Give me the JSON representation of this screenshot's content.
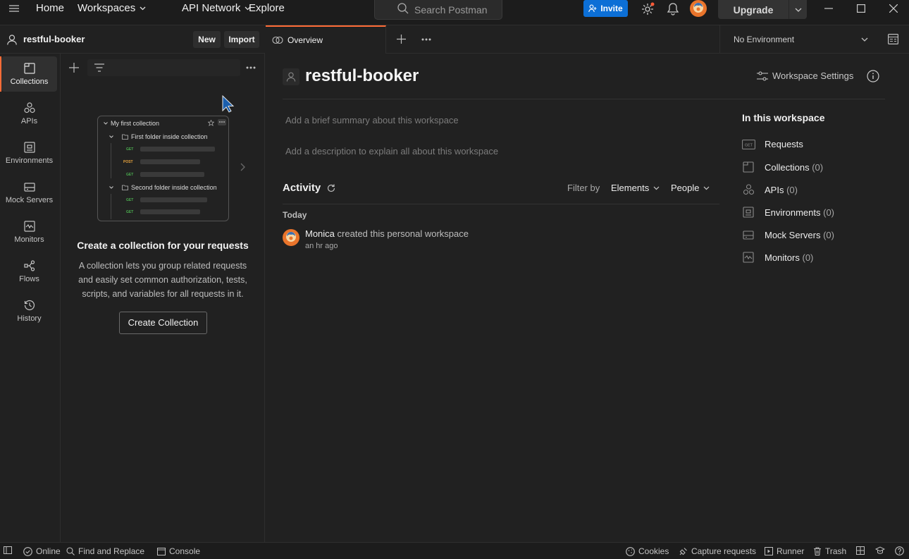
{
  "topbar": {
    "nav": [
      "Home",
      "Workspaces",
      "API Network",
      "Explore"
    ],
    "search_placeholder": "Search Postman",
    "invite_label": "Invite",
    "upgrade_label": "Upgrade"
  },
  "workspace": {
    "name": "restful-booker",
    "new_label": "New",
    "import_label": "Import"
  },
  "sidebar": {
    "items": [
      {
        "label": "Collections",
        "icon": "collections-icon",
        "active": true
      },
      {
        "label": "APIs",
        "icon": "apis-icon"
      },
      {
        "label": "Environments",
        "icon": "environments-icon"
      },
      {
        "label": "Mock Servers",
        "icon": "mock-servers-icon"
      },
      {
        "label": "Monitors",
        "icon": "monitors-icon"
      },
      {
        "label": "Flows",
        "icon": "flows-icon"
      },
      {
        "label": "History",
        "icon": "history-icon"
      }
    ]
  },
  "collections_panel": {
    "illustration": {
      "collection": "My first collection",
      "folder1": "First folder inside collection",
      "folder2": "Second folder inside collection",
      "methods": [
        "GET",
        "POST",
        "GET",
        "GET",
        "GET"
      ]
    },
    "heading": "Create a collection for your requests",
    "description_lines": [
      "A collection lets you group related requests",
      "and easily set common authorization, tests,",
      "scripts, and variables for all requests in it."
    ],
    "create_button": "Create Collection"
  },
  "tabs": {
    "overview_label": "Overview",
    "environment": "No Environment"
  },
  "overview": {
    "title": "restful-booker",
    "settings_label": "Workspace Settings",
    "summary_placeholder": "Add a brief summary about this workspace",
    "description_placeholder": "Add a description to explain all about this workspace",
    "activity": {
      "title": "Activity",
      "filter_by": "Filter by",
      "elements": "Elements",
      "people": "People",
      "day": "Today",
      "entry_user": "Monica",
      "entry_text": "created this personal workspace",
      "entry_time": "an hr ago"
    },
    "in_this_workspace": {
      "title": "In this workspace",
      "items": [
        {
          "label": "Requests",
          "count": ""
        },
        {
          "label": "Collections",
          "count": "(0)"
        },
        {
          "label": "APIs",
          "count": "(0)"
        },
        {
          "label": "Environments",
          "count": "(0)"
        },
        {
          "label": "Mock Servers",
          "count": "(0)"
        },
        {
          "label": "Monitors",
          "count": "(0)"
        }
      ]
    }
  },
  "statusbar": {
    "online": "Online",
    "find_replace": "Find and Replace",
    "console": "Console",
    "cookies": "Cookies",
    "capture": "Capture requests",
    "runner": "Runner",
    "trash": "Trash"
  },
  "colors": {
    "accent": "#ff6c37",
    "invite": "#0c6fd6"
  }
}
